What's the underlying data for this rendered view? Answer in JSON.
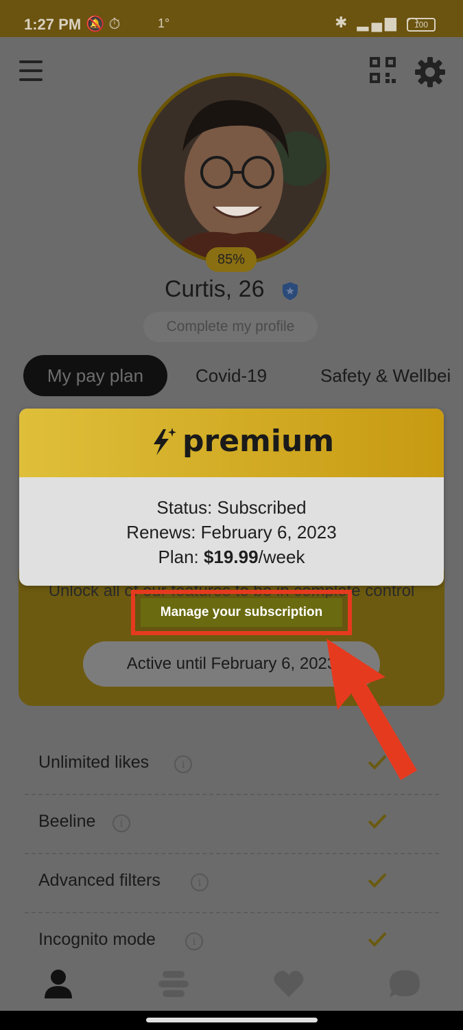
{
  "status_bar": {
    "time": "1:27 PM",
    "temperature": "1°",
    "battery": "100"
  },
  "profile": {
    "completion": "85%",
    "name": "Curtis, 26",
    "complete_profile_label": "Complete my profile"
  },
  "tabs": [
    {
      "label": "My pay plan"
    },
    {
      "label": "Covid-19"
    },
    {
      "label": "Safety & Wellbei"
    }
  ],
  "premium_card": {
    "brand": "premium",
    "status_line": "Status: Subscribed",
    "renews_line": "Renews: February 6, 2023",
    "plan_prefix": "Plan: ",
    "plan_price": "$19.99",
    "plan_suffix": "/week"
  },
  "plan_section": {
    "description": "Unlock all of our features to be in complete control of your experience",
    "active_until": "Active until February 6, 2023"
  },
  "manage_button": {
    "label": "Manage your subscription"
  },
  "features": [
    {
      "label": "Unlimited likes"
    },
    {
      "label": "Beeline"
    },
    {
      "label": "Advanced filters"
    },
    {
      "label": "Incognito mode"
    }
  ],
  "colors": {
    "accent_gold": "#dfbf3a",
    "highlight_red": "#e63a1f"
  }
}
